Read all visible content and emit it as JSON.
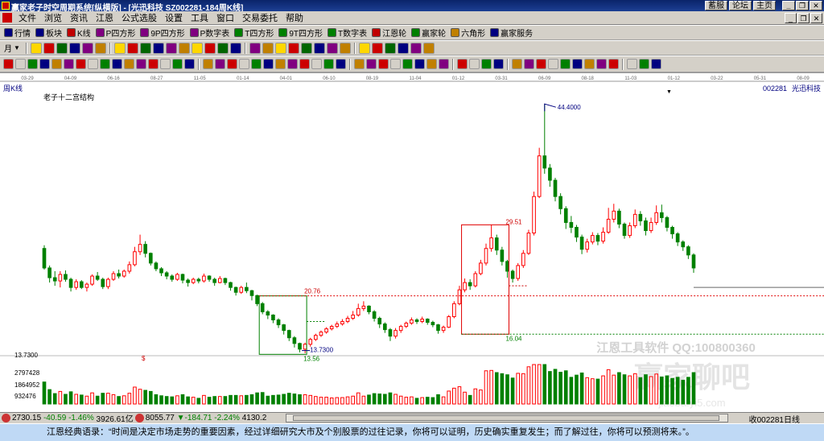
{
  "titlebar": {
    "title": "赢家老子时空周期系统[纵横版] - [光迅科技   SZ002281-184周K线]",
    "links": [
      "蓄服",
      "论坛",
      "主页"
    ],
    "controls": [
      "_",
      "❐",
      "✕"
    ]
  },
  "menu": {
    "items": [
      "文件",
      "浏览",
      "资讯",
      "江恩",
      "公式选股",
      "设置",
      "工具",
      "窗口",
      "交易委托",
      "帮助"
    ],
    "mdi_controls": [
      "_",
      "❐",
      "✕"
    ]
  },
  "toolbar1": {
    "items": [
      {
        "label": "行情",
        "color": "#000080"
      },
      {
        "label": "板块",
        "color": "#000080"
      },
      {
        "label": "K线",
        "color": "#c00000"
      },
      {
        "label": "P四方形",
        "color": "#800080"
      },
      {
        "label": "9P四方形",
        "color": "#800080"
      },
      {
        "label": "P数字表",
        "color": "#800080"
      },
      {
        "label": "T四方形",
        "color": "#008000"
      },
      {
        "label": "9T四方形",
        "color": "#008000"
      },
      {
        "label": "T数字表",
        "color": "#008000"
      },
      {
        "label": "江恩轮",
        "color": "#c00000"
      },
      {
        "label": "赢家轮",
        "color": "#008000"
      },
      {
        "label": "六角形",
        "color": "#c08000"
      },
      {
        "label": "赢家服务",
        "color": "#000080"
      }
    ]
  },
  "toolbar2": {
    "period_label": "月",
    "period_icon": "chevron-down-icon"
  },
  "chart": {
    "period_label": "周K线",
    "indicator_title": "老子十二宫结构",
    "stock_code": "002281",
    "stock_name": "光迅科技",
    "top_dates": [
      "03-29",
      "04-09",
      "06-16",
      "08-27",
      "11-05",
      "01-14",
      "04-01",
      "06-10",
      "08-19",
      "11-04",
      "01-12",
      "03-31",
      "06-09",
      "08-18",
      "11-03",
      "01-12",
      "03-22",
      "05-31",
      "08-09"
    ],
    "vol_labels": [
      "13.7300",
      "2797428",
      "1864952",
      "932476"
    ],
    "dollar_mark": "$",
    "watermark1": "江恩工具软件 QQ:100800360",
    "watermark2": "赢家聊吧",
    "watermark3": "jiaoba.yi5.com",
    "colors": {
      "up": "#ff0000",
      "down": "#008000",
      "box": "#e00000",
      "green_box": "#008000"
    }
  },
  "chart_data": {
    "type": "candlestick",
    "title": "老子十二宫结构",
    "series": [
      {
        "name": "光迅科技 002281"
      }
    ],
    "annotations": [
      {
        "text": "44.4000",
        "value": 44.4
      },
      {
        "text": "29.51",
        "value": 29.51
      },
      {
        "text": "20.76",
        "value": 20.76
      },
      {
        "text": "16.04",
        "value": 16.04
      },
      {
        "text": "13.7300",
        "value": 13.73
      },
      {
        "text": "13.56",
        "value": 13.56
      }
    ],
    "y_range": [
      12.5,
      46.0
    ],
    "values": [
      [
        26.6,
        24.2,
        27.0,
        24.0
      ],
      [
        24.2,
        23.0,
        24.5,
        22.4
      ],
      [
        23.0,
        22.6,
        23.8,
        22.0
      ],
      [
        22.6,
        23.4,
        23.8,
        21.8
      ],
      [
        23.4,
        22.8,
        23.9,
        22.5
      ],
      [
        22.8,
        21.8,
        23.0,
        21.3
      ],
      [
        21.8,
        22.5,
        22.8,
        21.5
      ],
      [
        22.5,
        21.8,
        22.7,
        21.6
      ],
      [
        21.8,
        22.2,
        22.4,
        21.3
      ],
      [
        22.2,
        23.2,
        23.4,
        22.0
      ],
      [
        23.2,
        22.8,
        23.7,
        22.6
      ],
      [
        22.8,
        21.9,
        23.0,
        21.6
      ],
      [
        21.9,
        22.8,
        23.0,
        21.6
      ],
      [
        22.8,
        23.5,
        23.8,
        22.6
      ],
      [
        23.5,
        23.2,
        24.0,
        22.9
      ],
      [
        23.2,
        23.8,
        24.0,
        23.0
      ],
      [
        23.8,
        24.6,
        25.0,
        23.5
      ],
      [
        24.6,
        26.2,
        26.8,
        24.4
      ],
      [
        26.2,
        27.1,
        28.3,
        25.8
      ],
      [
        27.1,
        26.0,
        27.5,
        25.5
      ],
      [
        26.0,
        24.8,
        26.1,
        24.5
      ],
      [
        24.8,
        24.1,
        25.0,
        23.8
      ],
      [
        24.1,
        23.6,
        24.3,
        23.2
      ],
      [
        23.6,
        23.2,
        23.8,
        22.8
      ],
      [
        23.2,
        22.8,
        23.4,
        22.5
      ],
      [
        22.8,
        23.4,
        23.6,
        22.6
      ],
      [
        23.4,
        22.7,
        23.5,
        22.3
      ],
      [
        22.7,
        22.4,
        22.9,
        21.9
      ],
      [
        22.4,
        22.8,
        23.0,
        22.2
      ],
      [
        22.8,
        22.6,
        23.0,
        22.3
      ],
      [
        22.6,
        23.2,
        23.5,
        22.4
      ],
      [
        23.2,
        22.8,
        23.3,
        22.5
      ],
      [
        22.8,
        22.4,
        23.0,
        22.0
      ],
      [
        22.4,
        22.9,
        23.2,
        22.3
      ],
      [
        22.9,
        22.4,
        23.0,
        22.1
      ],
      [
        22.4,
        21.8,
        22.5,
        21.4
      ],
      [
        21.8,
        21.2,
        21.9,
        20.8
      ],
      [
        21.2,
        21.8,
        22.0,
        21.0
      ],
      [
        21.8,
        21.4,
        22.4,
        21.1
      ],
      [
        21.4,
        20.8,
        21.5,
        20.2
      ],
      [
        20.8,
        19.8,
        20.9,
        19.5
      ],
      [
        19.8,
        18.8,
        20.0,
        18.5
      ],
      [
        18.8,
        18.4,
        19.0,
        17.9
      ],
      [
        18.4,
        17.8,
        18.5,
        17.4
      ],
      [
        17.8,
        17.2,
        18.0,
        16.8
      ],
      [
        17.2,
        16.5,
        17.3,
        16.0
      ],
      [
        16.5,
        15.6,
        16.6,
        15.2
      ],
      [
        15.6,
        14.9,
        15.8,
        14.4
      ],
      [
        14.9,
        14.2,
        15.0,
        13.8
      ],
      [
        14.2,
        14.8,
        15.0,
        13.7
      ],
      [
        14.8,
        15.4,
        15.6,
        14.5
      ],
      [
        15.4,
        15.9,
        16.1,
        15.2
      ],
      [
        15.9,
        16.3,
        16.5,
        15.7
      ],
      [
        16.3,
        16.7,
        16.9,
        16.1
      ],
      [
        16.7,
        17.0,
        17.2,
        16.5
      ],
      [
        17.0,
        17.3,
        17.6,
        16.8
      ],
      [
        17.3,
        17.6,
        17.9,
        17.1
      ],
      [
        17.6,
        18.0,
        18.3,
        17.4
      ],
      [
        18.0,
        18.4,
        18.9,
        17.8
      ],
      [
        18.4,
        19.2,
        19.8,
        18.2
      ],
      [
        19.2,
        19.5,
        20.1,
        18.9
      ],
      [
        19.5,
        18.8,
        19.6,
        18.5
      ],
      [
        18.8,
        18.0,
        19.0,
        17.6
      ],
      [
        18.0,
        17.3,
        18.2,
        16.8
      ],
      [
        17.3,
        16.6,
        17.5,
        16.2
      ],
      [
        16.6,
        15.8,
        16.8,
        15.2
      ],
      [
        15.8,
        16.5,
        16.8,
        15.5
      ],
      [
        16.5,
        17.0,
        17.2,
        16.2
      ],
      [
        17.0,
        17.4,
        17.6,
        16.8
      ],
      [
        17.4,
        17.8,
        18.1,
        17.2
      ],
      [
        17.8,
        17.6,
        18.0,
        17.3
      ],
      [
        17.6,
        17.9,
        18.2,
        17.4
      ],
      [
        17.9,
        17.5,
        18.0,
        17.2
      ],
      [
        17.5,
        17.2,
        17.7,
        16.9
      ],
      [
        17.2,
        16.5,
        17.3,
        16.1
      ],
      [
        16.5,
        16.9,
        17.1,
        16.2
      ],
      [
        16.9,
        18.2,
        18.4,
        16.8
      ],
      [
        18.2,
        19.8,
        20.1,
        18.0
      ],
      [
        19.8,
        21.5,
        22.0,
        19.6
      ],
      [
        21.5,
        22.4,
        22.9,
        21.2
      ],
      [
        22.4,
        22.0,
        22.8,
        21.5
      ],
      [
        22.0,
        23.5,
        23.8,
        21.8
      ],
      [
        23.5,
        24.8,
        25.2,
        23.3
      ],
      [
        24.8,
        26.6,
        27.2,
        24.5
      ],
      [
        26.6,
        27.9,
        29.5,
        26.2
      ],
      [
        27.9,
        26.4,
        28.3,
        25.8
      ],
      [
        26.4,
        25.0,
        26.8,
        24.5
      ],
      [
        25.0,
        23.8,
        25.2,
        23.0
      ],
      [
        23.8,
        22.9,
        24.0,
        22.4
      ],
      [
        22.9,
        24.5,
        24.8,
        22.6
      ],
      [
        24.5,
        26.0,
        26.4,
        24.2
      ],
      [
        26.0,
        28.5,
        28.9,
        25.8
      ],
      [
        28.5,
        33.0,
        33.6,
        28.2
      ],
      [
        33.0,
        38.0,
        39.0,
        32.8
      ],
      [
        38.0,
        36.5,
        44.4,
        35.8
      ],
      [
        36.5,
        35.0,
        37.0,
        34.2
      ],
      [
        35.0,
        33.0,
        35.3,
        32.4
      ],
      [
        33.0,
        31.5,
        33.4,
        30.8
      ],
      [
        31.5,
        29.8,
        31.8,
        29.0
      ],
      [
        29.8,
        29.2,
        30.6,
        28.5
      ],
      [
        29.2,
        28.0,
        29.5,
        27.4
      ],
      [
        28.0,
        26.5,
        28.3,
        25.9
      ],
      [
        26.5,
        27.4,
        27.8,
        26.1
      ],
      [
        27.4,
        28.2,
        28.6,
        27.1
      ],
      [
        28.2,
        27.5,
        28.5,
        27.0
      ],
      [
        27.5,
        28.6,
        29.2,
        27.2
      ],
      [
        28.6,
        30.2,
        31.6,
        28.4
      ],
      [
        30.2,
        31.2,
        32.1,
        29.8
      ],
      [
        31.2,
        29.6,
        31.5,
        29.1
      ],
      [
        29.6,
        28.2,
        29.8,
        27.8
      ],
      [
        28.2,
        29.4,
        29.8,
        27.9
      ],
      [
        29.4,
        30.8,
        31.4,
        29.1
      ],
      [
        30.8,
        30.0,
        31.2,
        29.4
      ],
      [
        30.0,
        28.8,
        30.4,
        28.2
      ],
      [
        28.8,
        29.8,
        30.4,
        28.5
      ],
      [
        29.8,
        31.0,
        31.9,
        29.5
      ],
      [
        31.0,
        30.4,
        32.0,
        29.8
      ],
      [
        30.4,
        29.2,
        30.6,
        28.7
      ],
      [
        29.2,
        28.4,
        29.4,
        27.8
      ],
      [
        28.4,
        27.4,
        28.6,
        26.9
      ],
      [
        27.4,
        26.8,
        27.6,
        26.3
      ],
      [
        26.8,
        25.8,
        27.0,
        25.3
      ],
      [
        25.8,
        24.2,
        26.0,
        23.6
      ]
    ]
  },
  "statusbar": {
    "sh_value": "2730.15",
    "sh_change": "-40.59",
    "sh_pct": "-1.46%",
    "sh_amount": "3926.61亿",
    "sz_value": "8055.77",
    "sz_change": "▼-184.71",
    "sz_pct": "-2.24%",
    "sz_amount": "4130.2",
    "right_text": "收002281日线"
  },
  "quote": {
    "text": "江恩经典语录：“时间是决定市场走势的重要因素，经过详细研究大市及个别股票的过往记录，你将可以证明，历史确实重复发生；而了解过往，你将可以预测将来。”。"
  }
}
